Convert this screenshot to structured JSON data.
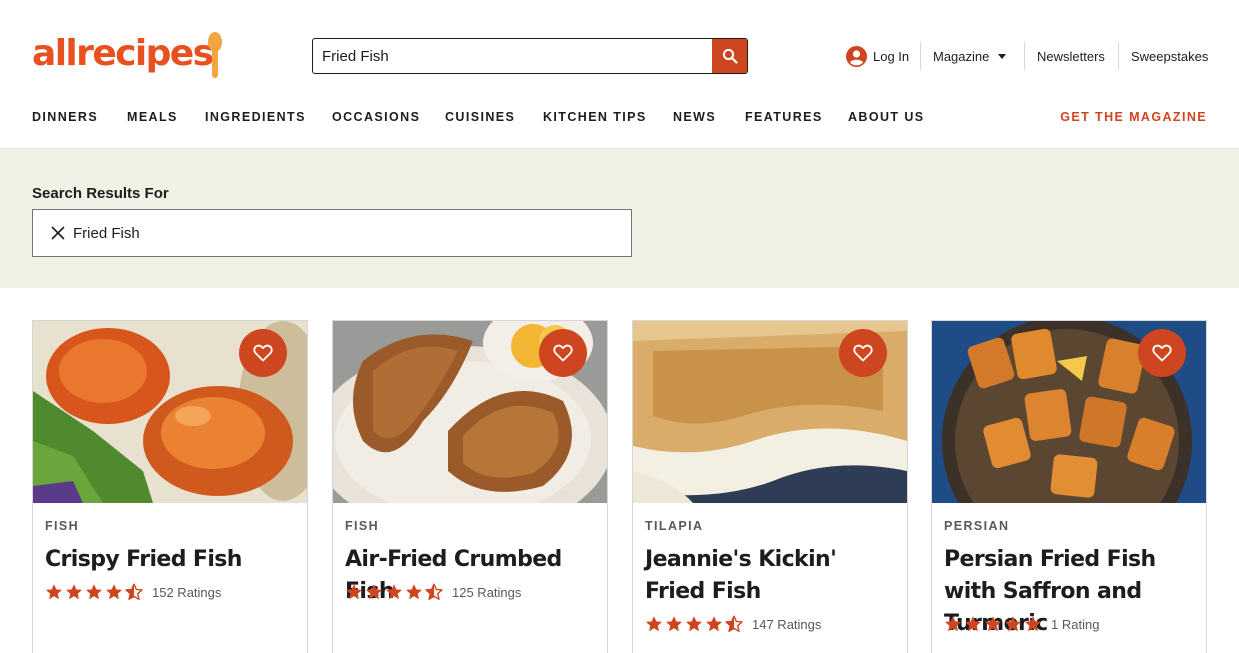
{
  "brand": {
    "logo_text": "allrecipes",
    "accent": "#ce4620",
    "logo_color": "#e8501f",
    "spoon_color": "#f2a541"
  },
  "header": {
    "search": {
      "value": "Fried Fish",
      "icon": "search-icon"
    },
    "login_label": "Log In",
    "magazine_label": "Magazine",
    "newsletters_label": "Newsletters",
    "sweepstakes_label": "Sweepstakes"
  },
  "nav": {
    "items": [
      "DINNERS",
      "MEALS",
      "INGREDIENTS",
      "OCCASIONS",
      "CUISINES",
      "KITCHEN TIPS",
      "NEWS",
      "FEATURES",
      "ABOUT US"
    ],
    "cta": "GET THE MAGAZINE"
  },
  "search_results": {
    "label": "Search Results For",
    "query": "Fried Fish",
    "band_color": "#f1f1e6"
  },
  "cards": [
    {
      "tag": "FISH",
      "title": "Crispy Fried Fish",
      "rating": 4.5,
      "ratings_text": "152 Ratings"
    },
    {
      "tag": "FISH",
      "title": "Air-Fried Crumbed Fish",
      "rating": 4.5,
      "ratings_text": "125 Ratings"
    },
    {
      "tag": "TILAPIA",
      "title": "Jeannie's Kickin' Fried Fish",
      "rating": 4.5,
      "ratings_text": "147 Ratings"
    },
    {
      "tag": "PERSIAN",
      "title": "Persian Fried Fish with Saffron and Turmeric",
      "rating": 5,
      "ratings_text": "1 Rating"
    }
  ]
}
